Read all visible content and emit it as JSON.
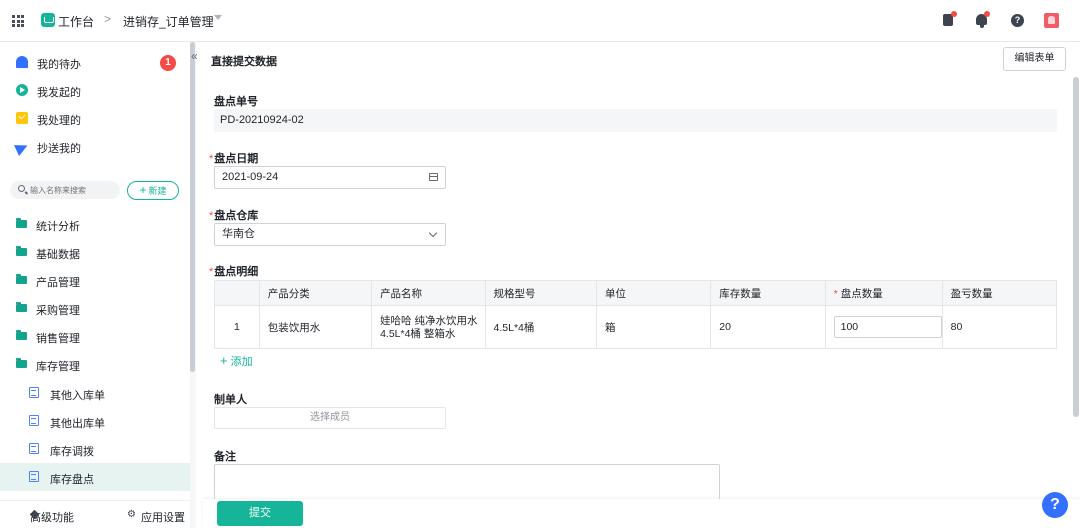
{
  "topbar": {
    "home_label": "工作台",
    "separator": ">",
    "current_app": "进销存_订单管理"
  },
  "sidebar": {
    "top_items": [
      {
        "label": "我的待办",
        "badge": "1"
      },
      {
        "label": "我发起的"
      },
      {
        "label": "我处理的"
      },
      {
        "label": "抄送我的"
      }
    ],
    "search_placeholder": "输入名称来搜索",
    "new_button": "新建",
    "folders": [
      "统计分析",
      "基础数据",
      "产品管理",
      "采购管理",
      "销售管理",
      "库存管理"
    ],
    "sub_items": [
      "其他入库单",
      "其他出库单",
      "库存调拨",
      "库存盘点"
    ],
    "active_sub_item": "库存盘点",
    "footer": {
      "advanced": "高级功能",
      "settings": "应用设置"
    }
  },
  "main": {
    "title": "直接提交数据",
    "edit_form_button": "编辑表单",
    "fields": {
      "order_no_label": "盘点单号",
      "order_no_value": "PD-20210924-02",
      "date_label": "盘点日期",
      "date_value": "2021-09-24",
      "warehouse_label": "盘点仓库",
      "warehouse_value": "华南仓",
      "detail_label": "盘点明细",
      "creator_label": "制单人",
      "creator_placeholder": "选择成员",
      "remark_label": "备注"
    },
    "required_mark": "*",
    "table": {
      "headers": [
        "",
        "产品分类",
        "产品名称",
        "规格型号",
        "单位",
        "库存数量",
        "盘点数量",
        "盈亏数量"
      ],
      "rows": [
        {
          "index": "1",
          "category": "包装饮用水",
          "name": "娃哈哈 纯净水饮用水4.5L*4桶 整箱水",
          "spec": "4.5L*4桶",
          "unit": "箱",
          "stock_qty": "20",
          "count_qty": "100",
          "diff_qty": "80"
        }
      ]
    },
    "add_row": "添加",
    "submit": "提交"
  },
  "colors": {
    "brand": "#16b59a",
    "danger": "#f54a45",
    "link_blue": "#3370ff"
  }
}
